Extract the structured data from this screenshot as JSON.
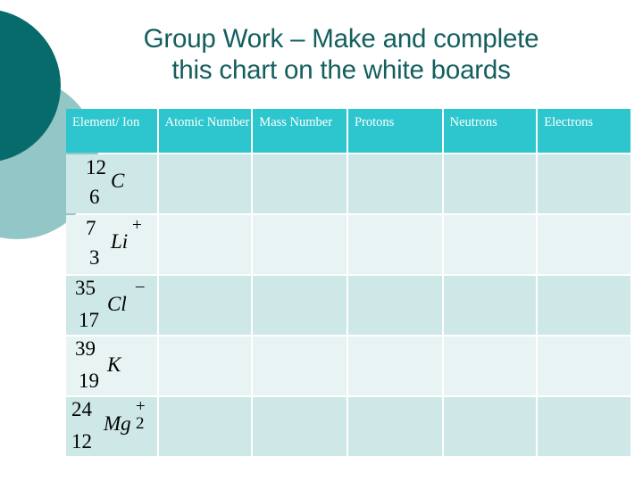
{
  "slide": {
    "title": "Group Work – Make and complete\nthis chart on the white boards",
    "title_color": "#155e5e",
    "background_color": "#ffffff"
  },
  "decor": {
    "circle_dark_color": "#086b6b",
    "circle_light_color": "#93c6c6"
  },
  "table": {
    "header_background": "#2ec6ce",
    "header_text_color": "#ffffff",
    "row_color_a": "#cde8e7",
    "row_color_b": "#e8f4f3",
    "gridline_color": "#ffffff",
    "columns": [
      {
        "label": "Element/\nIon"
      },
      {
        "label": "Atomic\nNumber"
      },
      {
        "label": "Mass\nNumber"
      },
      {
        "label": "Protons"
      },
      {
        "label": "Neutrons"
      },
      {
        "label": "Electrons"
      }
    ],
    "rows": [
      {
        "isotope": {
          "mass_number": "12",
          "atomic_number": "6",
          "symbol": "C",
          "charge": ""
        },
        "atomic": "",
        "mass": "",
        "protons": "",
        "neutrons": "",
        "electrons": ""
      },
      {
        "isotope": {
          "mass_number": "7",
          "atomic_number": "3",
          "symbol": "Li",
          "charge": "+"
        },
        "atomic": "",
        "mass": "",
        "protons": "",
        "neutrons": "",
        "electrons": ""
      },
      {
        "isotope": {
          "mass_number": "35",
          "atomic_number": "17",
          "symbol": "Cl",
          "charge": "–"
        },
        "atomic": "",
        "mass": "",
        "protons": "",
        "neutrons": "",
        "electrons": ""
      },
      {
        "isotope": {
          "mass_number": "39",
          "atomic_number": "19",
          "symbol": "K",
          "charge": ""
        },
        "atomic": "",
        "mass": "",
        "protons": "",
        "neutrons": "",
        "electrons": ""
      },
      {
        "isotope": {
          "mass_number": "24",
          "atomic_number": "12",
          "symbol": "Mg",
          "charge": "+ 2"
        },
        "atomic": "",
        "mass": "",
        "protons": "",
        "neutrons": "",
        "electrons": ""
      }
    ]
  }
}
